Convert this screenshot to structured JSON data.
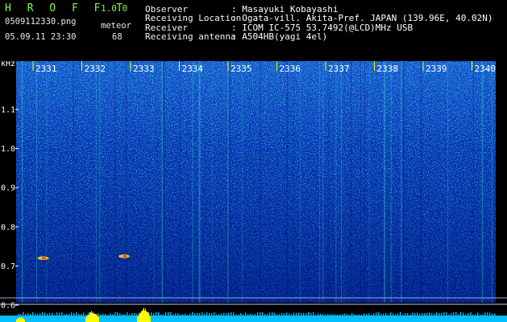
{
  "app": {
    "name": "H R O F F T",
    "version": "1.0.0"
  },
  "file": {
    "name": "0509112330.png",
    "datetime": "05.09.11 23:30"
  },
  "detection": {
    "label": "meteor",
    "count": "68"
  },
  "info": {
    "observer_label": "Observer",
    "observer_value": ": Masayuki Kobayashi",
    "location_label": "Receiving Location",
    "location_value": ": Ogata-vill. Akita-Pref. JAPAN (139.96E, 40.02N)",
    "receiver_label": "Receiver",
    "receiver_value": ": ICOM IC-575 53.7492(@LCD)MHz USB",
    "antenna_label": "Receiving antenna",
    "antenna_value": ": A504HB(yagi 4el)"
  },
  "chart_data": {
    "type": "heatmap",
    "yunit": "kHz",
    "yticks": [
      "1.1",
      "1.0",
      "0.9",
      "0.8",
      "0.7",
      "0.6"
    ],
    "ylim": [
      0.6,
      1.18
    ],
    "xticks": [
      "2331",
      "2332",
      "2333",
      "2334",
      "2335",
      "2336",
      "2337",
      "2338",
      "2339",
      "2340"
    ],
    "echoes": [
      {
        "time": "2332",
        "freq": 0.72
      },
      {
        "time": "2333",
        "freq": 0.725
      }
    ]
  },
  "colors": {
    "background": "#000000",
    "title": "#7cfc3c",
    "tick": "#ffff00",
    "bar": "#ffff00",
    "floor": "#00c0ff"
  }
}
